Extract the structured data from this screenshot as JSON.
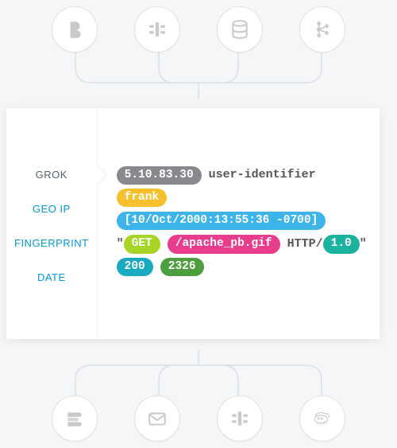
{
  "tabs": {
    "grok": "GROK",
    "geoip": "GEO IP",
    "fingerprint": "FINGERPRINT",
    "date": "DATE"
  },
  "log": {
    "ip": "5.10.83.30",
    "identity": "user-identifier",
    "user": "frank",
    "timestamp": "[10/Oct/2000:13:55:36 -0700]",
    "quote_open": "\"",
    "method": "GET",
    "path": "/apache_pb.gif",
    "http_label": "HTTP/",
    "http_version": "1.0",
    "quote_close": "\"",
    "status": "200",
    "bytes": "2326"
  }
}
